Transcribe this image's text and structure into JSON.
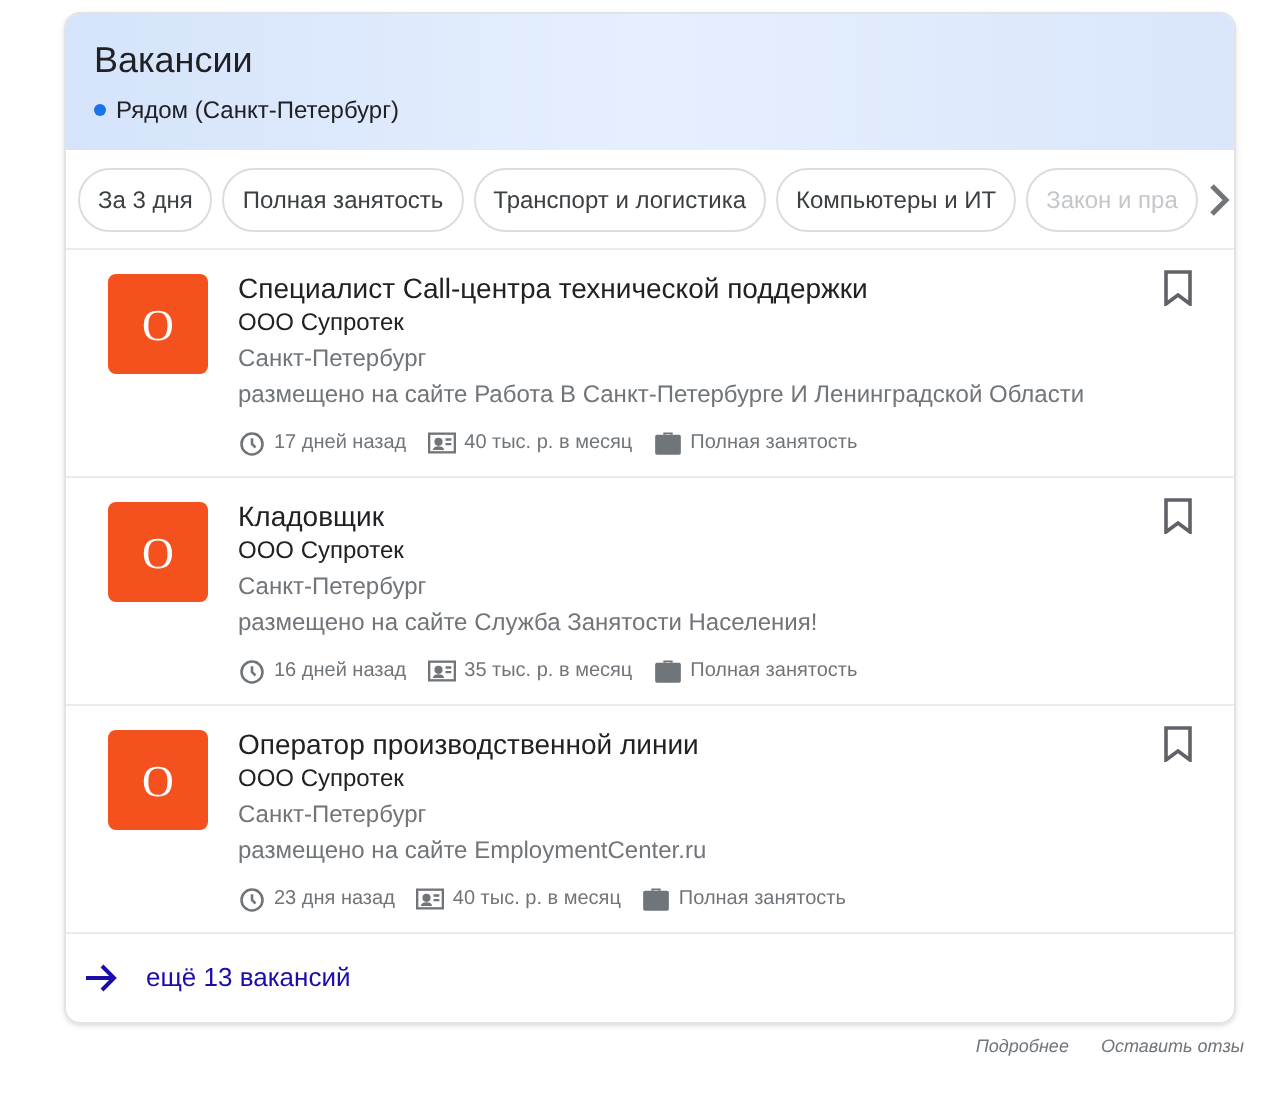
{
  "header": {
    "title": "Вакансии",
    "location": "Рядом (Санкт-Петербург)"
  },
  "filters": [
    {
      "label": "За 3 дня",
      "faded": false
    },
    {
      "label": "Полная занятость",
      "faded": false
    },
    {
      "label": "Транспорт и логистика",
      "faded": false
    },
    {
      "label": "Компьютеры и ИТ",
      "faded": false
    },
    {
      "label": "Закон и пра",
      "faded": true
    }
  ],
  "jobs": [
    {
      "logo": "О",
      "title": "Специалист Call-центра технической поддержки",
      "company": "ООО Супротек",
      "city": "Санкт-Петербург",
      "source": "размещено на сайте Работа В Санкт-Петербурге И Ленинградской Области",
      "posted": "17 дней назад",
      "salary": "40 тыс. р. в месяц",
      "employment": "Полная занятость"
    },
    {
      "logo": "О",
      "title": "Кладовщик",
      "company": "ООО Супротек",
      "city": "Санкт-Петербург",
      "source": "размещено на сайте Служба Занятости Населения!",
      "posted": "16 дней назад",
      "salary": "35 тыс. р. в месяц",
      "employment": "Полная занятость"
    },
    {
      "logo": "О",
      "title": "Оператор производственной линии",
      "company": "ООО Супротек",
      "city": "Санкт-Петербург",
      "source": "размещено на сайте EmploymentCenter.ru",
      "posted": "23 дня назад",
      "salary": "40 тыс. р. в месяц",
      "employment": "Полная занятость"
    }
  ],
  "more_link": "ещё 13 вакансий",
  "footer_links": [
    "Подробнее",
    "Оставить отзы"
  ]
}
